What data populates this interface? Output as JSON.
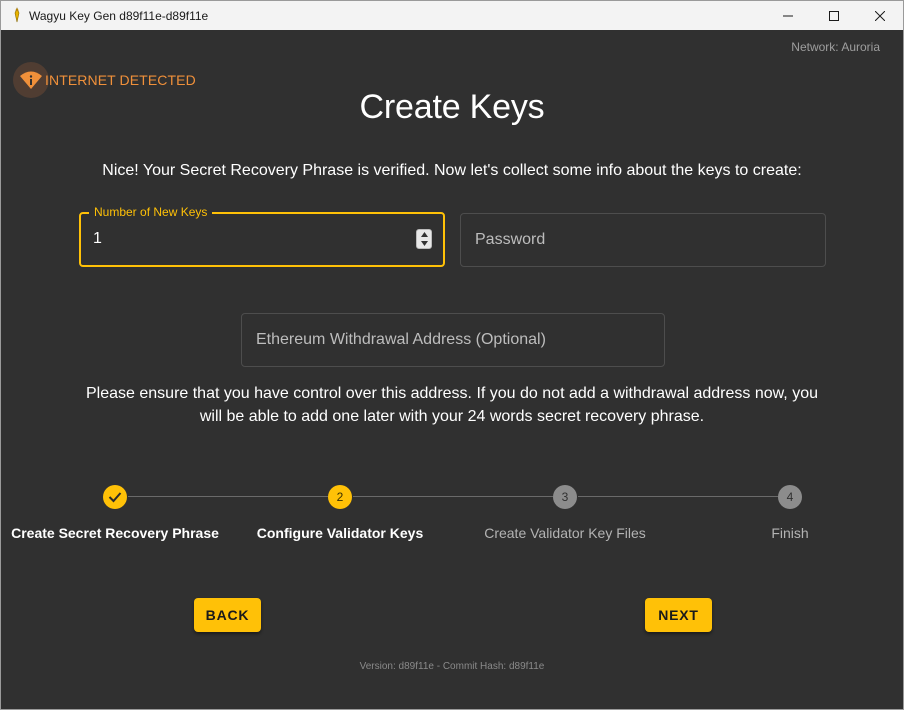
{
  "window": {
    "title": "Wagyu Key Gen d89f11e-d89f11e",
    "controls": {
      "minimize_icon": "minimize-icon",
      "maximize_icon": "maximize-icon",
      "close_icon": "close-icon"
    }
  },
  "header": {
    "network": "Network: Auroria",
    "internet_warning": "INTERNET DETECTED",
    "internet_icon": "wifi-warning-icon",
    "warning_color": "#f0903a"
  },
  "main": {
    "title": "Create Keys",
    "intro": "Nice! Your Secret Recovery Phrase is verified. Now let's collect some info about the keys to create:",
    "fields": {
      "num_keys": {
        "label": "Number of New Keys",
        "value": "1"
      },
      "password": {
        "placeholder": "Password"
      },
      "withdrawal": {
        "placeholder": "Ethereum Withdrawal Address (Optional)"
      }
    },
    "note": "Please ensure that you have control over this address. If you do not add a withdrawal address now, you will be able to add one later with your 24 words secret recovery phrase."
  },
  "stepper": {
    "steps": [
      {
        "label": "Create Secret Recovery Phrase",
        "number": "",
        "state": "completed"
      },
      {
        "label": "Configure Validator Keys",
        "number": "2",
        "state": "active"
      },
      {
        "label": "Create Validator Key Files",
        "number": "3",
        "state": "pending"
      },
      {
        "label": "Finish",
        "number": "4",
        "state": "pending"
      }
    ]
  },
  "actions": {
    "back_label": "BACK",
    "next_label": "NEXT"
  },
  "footer": {
    "version": "Version: d89f11e - Commit Hash: d89f11e"
  },
  "colors": {
    "accent": "#ffc107",
    "background": "#303030"
  }
}
